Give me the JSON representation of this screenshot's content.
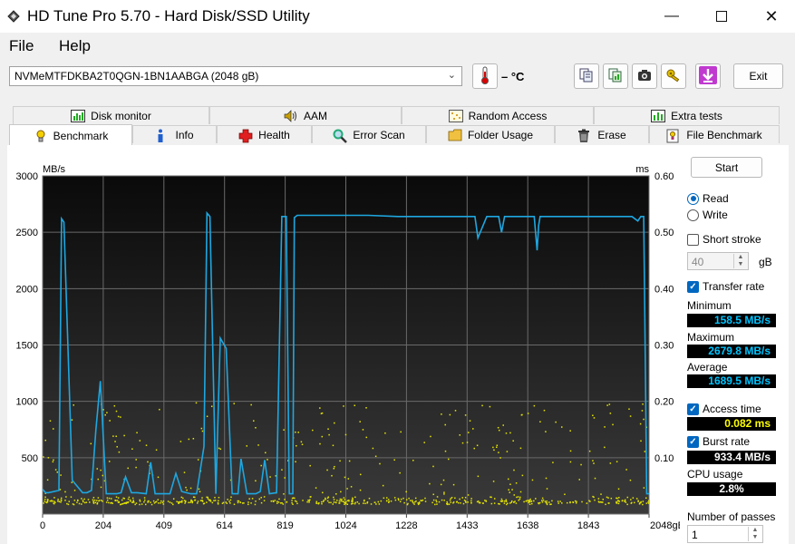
{
  "window": {
    "title": "HD Tune Pro 5.70 - Hard Disk/SSD Utility"
  },
  "menu": {
    "file": "File",
    "help": "Help"
  },
  "toolbar": {
    "drive": "NVMeMTFDKBA2T0QGN-1BN1AABGA (2048 gB)",
    "temperature": "– °C",
    "exit_label": "Exit"
  },
  "tabs_top": [
    {
      "label": "Disk monitor",
      "icon": "disk-monitor-icon"
    },
    {
      "label": "AAM",
      "icon": "speaker-icon"
    },
    {
      "label": "Random Access",
      "icon": "random-access-icon"
    },
    {
      "label": "Extra tests",
      "icon": "extra-tests-icon"
    }
  ],
  "tabs_bottom": [
    {
      "label": "Benchmark",
      "icon": "benchmark-icon",
      "active": true
    },
    {
      "label": "Info",
      "icon": "info-icon"
    },
    {
      "label": "Health",
      "icon": "health-cross-icon"
    },
    {
      "label": "Error Scan",
      "icon": "magnifier-icon"
    },
    {
      "label": "Folder Usage",
      "icon": "folder-icon"
    },
    {
      "label": "Erase",
      "icon": "trash-icon"
    },
    {
      "label": "File Benchmark",
      "icon": "file-benchmark-icon"
    }
  ],
  "controls": {
    "start_label": "Start",
    "read_label": "Read",
    "write_label": "Write",
    "mode": "read",
    "short_stroke_label": "Short stroke",
    "short_stroke_checked": false,
    "short_stroke_value": "40",
    "short_stroke_unit": "gB",
    "transfer_rate_label": "Transfer rate",
    "transfer_rate_checked": true,
    "minimum_label": "Minimum",
    "minimum_value": "158.5 MB/s",
    "maximum_label": "Maximum",
    "maximum_value": "2679.8 MB/s",
    "average_label": "Average",
    "average_value": "1689.5 MB/s",
    "access_time_label": "Access time",
    "access_time_checked": true,
    "access_time_value": "0.082 ms",
    "burst_rate_label": "Burst rate",
    "burst_rate_checked": true,
    "burst_rate_value": "933.4 MB/s",
    "cpu_usage_label": "CPU usage",
    "cpu_usage_value": "2.8%",
    "passes_label": "Number of passes",
    "passes_value": "1"
  },
  "chart_data": {
    "type": "line",
    "y_left_unit": "MB/s",
    "y_right_unit": "ms",
    "y_left_ticks": [
      "3000",
      "2500",
      "2000",
      "1500",
      "1000",
      "500"
    ],
    "y_right_ticks": [
      "0.60",
      "0.50",
      "0.40",
      "0.30",
      "0.20",
      "0.10"
    ],
    "x_ticks": [
      "0",
      "204",
      "409",
      "614",
      "819",
      "1024",
      "1228",
      "1433",
      "1638",
      "1843",
      "2048gB"
    ],
    "ylim": [
      0,
      3000
    ],
    "y2lim": [
      0,
      0.6
    ],
    "xlim": [
      0,
      2048
    ],
    "grid": true,
    "series": [
      {
        "color": "#1ea7e0",
        "x": [
          0,
          10,
          20,
          55,
          64,
          72,
          100,
          135,
          150,
          165,
          180,
          195,
          215,
          250,
          265,
          280,
          300,
          320,
          350,
          365,
          380,
          430,
          450,
          470,
          500,
          520,
          545,
          555,
          565,
          585,
          600,
          620,
          640,
          660,
          670,
          690,
          720,
          735,
          750,
          766,
          790,
          808,
          823,
          833,
          845,
          850,
          860,
          900,
          1000,
          1100,
          1200,
          1300,
          1400,
          1460,
          1470,
          1500,
          1540,
          1550,
          1560,
          1600,
          1660,
          1670,
          1675,
          1680,
          1700,
          1800,
          1900,
          1990,
          2010,
          2020,
          2030,
          2035,
          2040,
          2048
        ],
        "y": [
          220,
          190,
          190,
          210,
          2620,
          2590,
          300,
          190,
          190,
          210,
          750,
          1180,
          180,
          180,
          190,
          330,
          190,
          190,
          180,
          460,
          180,
          180,
          360,
          200,
          180,
          180,
          600,
          2670,
          2640,
          180,
          1560,
          1470,
          180,
          180,
          490,
          180,
          180,
          200,
          480,
          180,
          190,
          2640,
          2640,
          180,
          180,
          2630,
          2650,
          2650,
          2650,
          2650,
          2640,
          2640,
          2640,
          2640,
          2450,
          2640,
          2640,
          2500,
          2640,
          2640,
          2640,
          2340,
          2560,
          2640,
          2640,
          2640,
          2640,
          2640,
          2600,
          2640,
          2640,
          1400,
          180,
          180
        ]
      }
    ],
    "access_time_scatter": {
      "color": "#e6e600",
      "y_range_ms": [
        0.02,
        0.2
      ],
      "x_range": [
        0,
        2048
      ]
    }
  }
}
